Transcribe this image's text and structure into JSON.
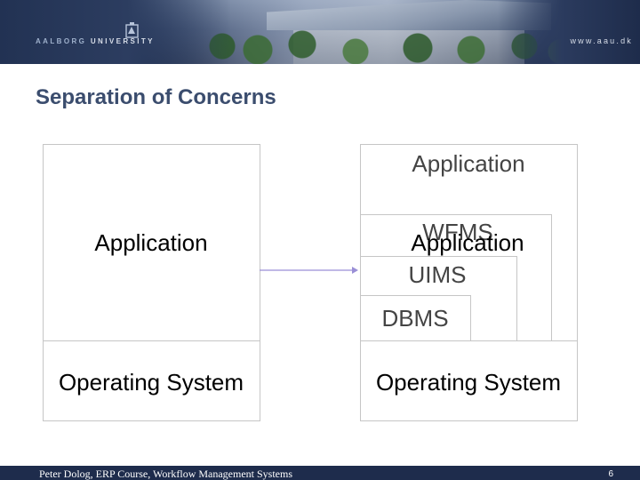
{
  "header": {
    "university_prefix": "AALBORG",
    "university_suffix": " UNIVERSITY",
    "website": "www.aau.dk",
    "logo_icon": "aau-seal-icon"
  },
  "slide": {
    "title": "Separation of Concerns"
  },
  "diagram": {
    "left": {
      "application_label": "Application",
      "os_label": "Operating System"
    },
    "right": {
      "application_label": "Application",
      "wfms_label": "WFMS",
      "wfms_application_label": "Application",
      "uims_label": "UIMS",
      "dbms_label": "DBMS",
      "os_label": "Operating System"
    },
    "arrow_icon": "right-arrow-icon"
  },
  "footer": {
    "text": "Peter Dolog, ERP Course, Workflow Management Systems",
    "page_number": "6"
  }
}
